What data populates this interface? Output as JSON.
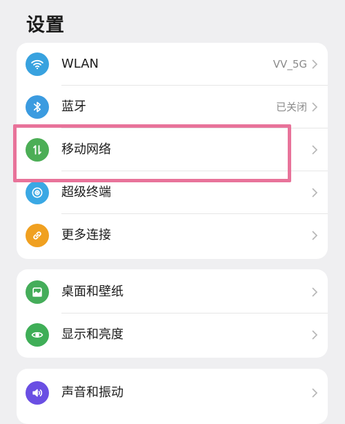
{
  "header": {
    "title": "设置"
  },
  "colors": {
    "wlan": "#38a2df",
    "bluetooth": "#3b9be0",
    "mobile_network": "#4cae56",
    "super_terminal": "#3aa8e4",
    "more_connections": "#f0a020",
    "desktop_wallpaper": "#45ad5a",
    "display_brightness": "#3fae57",
    "sound_vibration": "#6a4fe3",
    "highlight": "#e8739a"
  },
  "groups": [
    {
      "items": [
        {
          "label": "WLAN",
          "value": "VV_5G",
          "icon": "wifi-icon"
        },
        {
          "label": "蓝牙",
          "value": "已关闭",
          "icon": "bluetooth-icon"
        },
        {
          "label": "移动网络",
          "value": "",
          "icon": "mobile-data-icon"
        },
        {
          "label": "超级终端",
          "value": "",
          "icon": "super-terminal-icon"
        },
        {
          "label": "更多连接",
          "value": "",
          "icon": "link-icon"
        }
      ]
    },
    {
      "items": [
        {
          "label": "桌面和壁纸",
          "value": "",
          "icon": "image-icon"
        },
        {
          "label": "显示和亮度",
          "value": "",
          "icon": "eye-icon"
        }
      ]
    },
    {
      "items": [
        {
          "label": "声音和振动",
          "value": "",
          "icon": "speaker-icon"
        }
      ]
    }
  ]
}
